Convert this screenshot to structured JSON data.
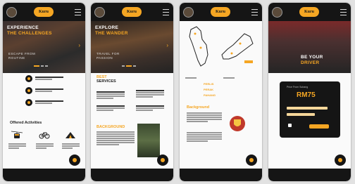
{
  "brand": {
    "logo_text": "Kuru",
    "accent": "#f5a623",
    "dark": "#151515"
  },
  "screens": [
    {
      "hero": {
        "title_line1": "EXPERIENCE",
        "title_line2": "THE CHALLENGES",
        "sub1": "ESCAPE FROM",
        "sub2": "ROUTINE"
      },
      "section_title": "Offered Activities",
      "icons": [
        "cable-car-icon",
        "bicycle-icon",
        "tent-icon"
      ]
    },
    {
      "hero": {
        "title_line1": "EXPLORE",
        "title_line2": "THE WANDER",
        "sub1": "TRAVEL FOR",
        "sub2": "PASSION"
      },
      "section_title_a": "BEST",
      "section_title_b": "SERVICES",
      "section2_title": "BACKGROUND"
    },
    {
      "map_labels": [
        "PERLIS",
        "PERAK",
        "PAHANG"
      ],
      "section_title": "Background"
    },
    {
      "hero": {
        "title_line1": "BE YOUR",
        "title_line2": "DRIVER"
      },
      "price_card": {
        "caption": "Price From Subang",
        "price": "RM75"
      }
    }
  ]
}
